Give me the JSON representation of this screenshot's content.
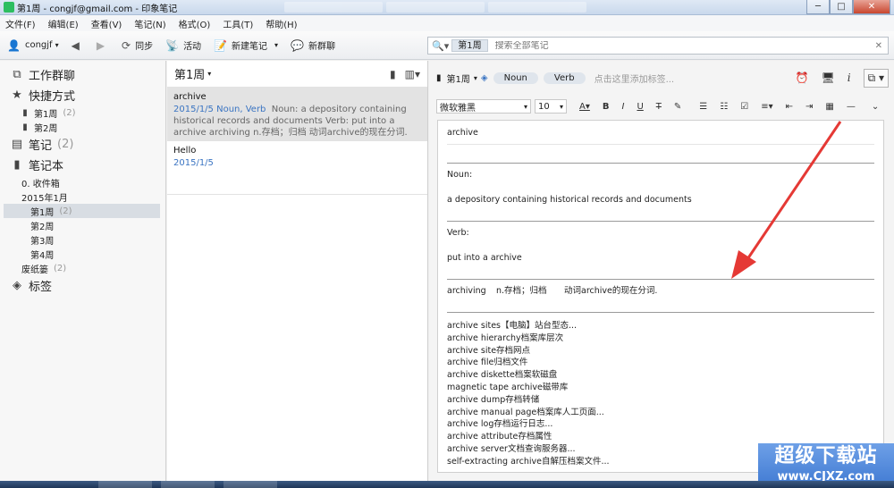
{
  "window": {
    "title": "第1周 - congjf@gmail.com - 印象笔记",
    "controls": {
      "minimize": "─",
      "maximize": "□",
      "close": "✕"
    }
  },
  "menu": [
    "文件(F)",
    "编辑(E)",
    "查看(V)",
    "笔记(N)",
    "格式(O)",
    "工具(T)",
    "帮助(H)"
  ],
  "toolbar": {
    "user": "congjf",
    "sync": "同步",
    "activity": "活动",
    "new_note": "新建笔记",
    "new_chat": "新群聊"
  },
  "search": {
    "scope": "第1周",
    "placeholder": "搜索全部笔记"
  },
  "sidebar": {
    "work_chat": "工作群聊",
    "shortcuts": "快捷方式",
    "shortcut_items": [
      {
        "label": "第1周",
        "count": "(2)"
      },
      {
        "label": "第2周",
        "count": ""
      }
    ],
    "notes": {
      "label": "笔记",
      "count": "(2)"
    },
    "notebooks": "笔记本",
    "notebook_items": [
      {
        "label": "0. 收件箱",
        "count": ""
      },
      {
        "label": "2015年1月",
        "count": ""
      },
      {
        "label": "第1周",
        "count": "(2)"
      },
      {
        "label": "第2周",
        "count": ""
      },
      {
        "label": "第3周",
        "count": ""
      },
      {
        "label": "第4周",
        "count": ""
      },
      {
        "label": "废纸篓",
        "count": "(2)"
      }
    ],
    "tags": "标签"
  },
  "notelist": {
    "title": "第1周",
    "notes": [
      {
        "title": "archive",
        "meta": "2015/1/5   Noun, Verb",
        "snippet": "Noun: a depository containing historical records and documents Verb: put into a archive archiving n.存档；归档 动词archive的现在分词."
      },
      {
        "title": "Hello",
        "meta": "2015/1/5",
        "snippet": ""
      }
    ]
  },
  "editor": {
    "notebook": "第1周",
    "tags": [
      "Noun",
      "Verb"
    ],
    "tag_hint": "点击这里添加标签...",
    "font": "微软雅黑",
    "size": "10",
    "format_buttons": [
      "B",
      "I",
      "U",
      "T"
    ],
    "note_title": "archive",
    "noun_heading": "Noun:",
    "noun_def": "a depository containing historical records and documents",
    "verb_heading": "Verb:",
    "verb_def": "put into a archive",
    "archiving_word": "archiving",
    "archiving_pos": "n.存档；归档",
    "archiving_note": "动词archive的现在分词.",
    "examples": [
      "archive sites【电脑】站台型态...",
      "archive hierarchy档案库层次",
      "archive site存档网点",
      "archive file归档文件",
      "archive diskette档案软磁盘",
      "magnetic tape archive磁带库",
      "archive dump存档转储",
      "archive manual page档案库人工页面...",
      "archive log存档运行日志...",
      "archive attribute存档属性",
      "archive server文档查询服务器...",
      "self-extracting archive自解压档案文件..."
    ]
  },
  "watermark": {
    "cn": "超级下载站",
    "url": "www.CJXZ.com"
  },
  "colors": {
    "arrow": "#e53935",
    "link": "#3a74c2",
    "accent": "#2dbe60"
  }
}
